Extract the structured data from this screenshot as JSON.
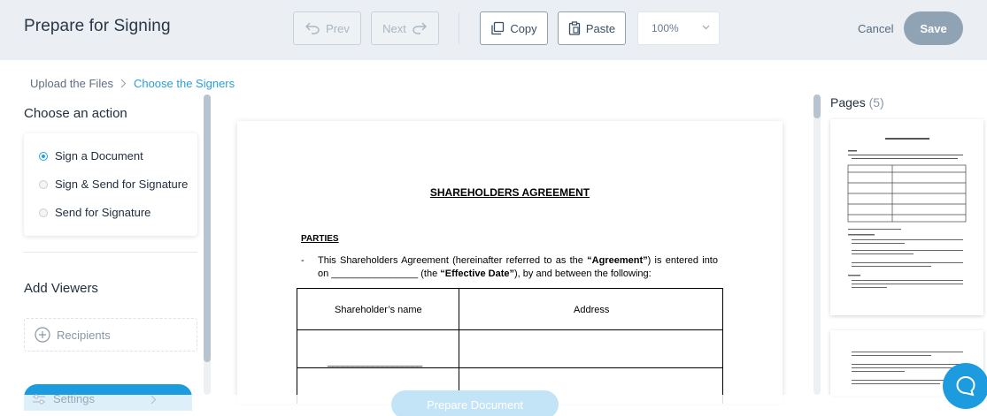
{
  "header": {
    "title": "Prepare for Signing",
    "prev_label": "Prev",
    "next_label": "Next",
    "copy_label": "Copy",
    "paste_label": "Paste",
    "zoom_value": "100%",
    "cancel_label": "Cancel",
    "save_label": "Save"
  },
  "breadcrumb": {
    "items": [
      "Upload the Files",
      "Choose the Signers"
    ]
  },
  "sidebar": {
    "action_heading": "Choose an action",
    "actions": [
      {
        "label": "Sign a Document",
        "selected": true
      },
      {
        "label": "Sign & Send for Signature",
        "selected": false
      },
      {
        "label": "Send for Signature",
        "selected": false
      }
    ],
    "viewers_heading": "Add Viewers",
    "recipients_label": "Recipients",
    "settings_label": "Settings"
  },
  "document": {
    "title": "SHAREHOLDERS AGREEMENT",
    "parties_heading": "PARTIES",
    "bullet": "-",
    "paragraph_part1": "This Shareholders Agreement (hereinafter referred to as the ",
    "paragraph_term1": "“Agreement”",
    "paragraph_part2": ") is entered into on ________________ (the ",
    "paragraph_term2": "“Effective Date”",
    "paragraph_part3": "), by and between the following:",
    "table_headers": [
      "Shareholder’s name",
      "Address"
    ],
    "table_blank": "___________________"
  },
  "pages_panel": {
    "heading": "Pages",
    "count": "(5)"
  },
  "footer": {
    "prepare_label": "Prepare Document"
  },
  "colors": {
    "accent": "#2a9fd8",
    "save_button": "#8fa3b4",
    "topbar": "#ebeff3"
  }
}
